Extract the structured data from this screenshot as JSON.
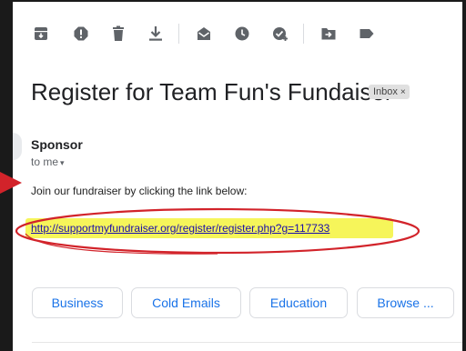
{
  "toolbar": {
    "buttons": [
      {
        "icon": "archive-icon"
      },
      {
        "icon": "report-spam-icon"
      },
      {
        "icon": "delete-icon"
      },
      {
        "icon": "download-icon"
      },
      {
        "icon": "mark-unread-icon"
      },
      {
        "icon": "snooze-icon"
      },
      {
        "icon": "add-to-tasks-icon"
      },
      {
        "icon": "move-to-icon"
      },
      {
        "icon": "label-icon"
      }
    ]
  },
  "email": {
    "subject": "Register for Team Fun's Fundaiser",
    "label_chip": "Inbox",
    "label_chip_close": "×",
    "sender": "Sponsor",
    "recipient": "to me",
    "recipient_caret": "▾",
    "body": "Join our fundraiser by clicking the link below:",
    "link": "http://supportmyfundraiser.org/register/register.php?g=117733"
  },
  "smart_replies": [
    "Business",
    "Cold Emails",
    "Education",
    "Browse ..."
  ],
  "colors": {
    "accent": "#1a73e8",
    "link": "#1a0dab",
    "highlight": "#f6f55a",
    "annotation": "#d2232a",
    "icon": "#5f6368"
  }
}
